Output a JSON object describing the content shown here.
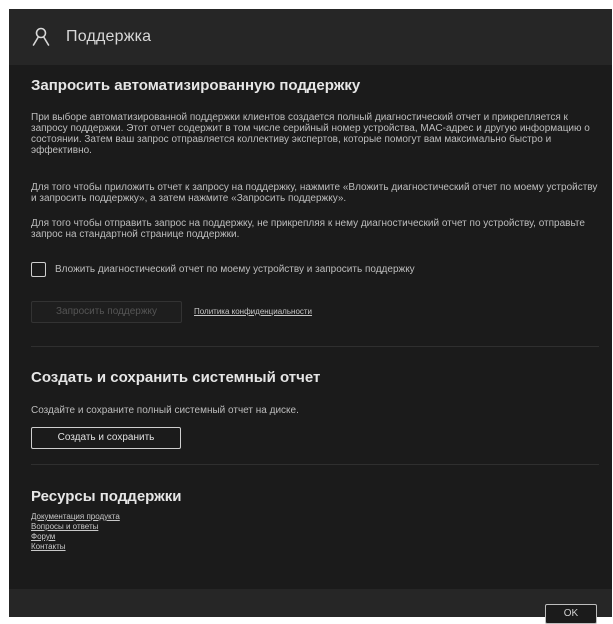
{
  "header": {
    "title": "Поддержка",
    "icon": "user-support-icon"
  },
  "auto_support": {
    "heading": "Запросить автоматизированную поддержку",
    "para1": "При выборе автоматизированной поддержки клиентов создается полный диагностический отчет и прикрепляется к запросу поддержки. Этот отчет содержит в том числе серийный номер устройства, MAC-адрес и другую информацию о состоянии. Затем ваш запрос отправляется коллективу экспертов, которые помогут вам максимально быстро и эффективно.",
    "para2": "Для того чтобы приложить отчет к запросу на поддержку, нажмите «Вложить диагностический отчет по моему устройству и запросить поддержку», а затем нажмите «Запросить поддержку».",
    "para3": "Для того чтобы отправить запрос на поддержку, не прикрепляя к нему диагностический отчет по устройству, отправьте запрос на стандартной странице поддержки.",
    "checkbox_label": "Вложить диагностический отчет по моему устройству и запросить поддержку",
    "checkbox_checked": false,
    "request_button": "Запросить поддержку",
    "privacy_link": "Политика конфиденциальности"
  },
  "system_report": {
    "heading": "Создать и сохранить системный отчет",
    "desc": "Создайте и сохраните полный системный отчет на диске.",
    "button": "Создать и сохранить"
  },
  "resources": {
    "heading": "Ресурсы поддержки",
    "links": [
      "Документация продукта",
      "Вопросы и ответы",
      "Форум",
      "Контакты"
    ]
  },
  "footer": {
    "ok_button": "OK"
  }
}
